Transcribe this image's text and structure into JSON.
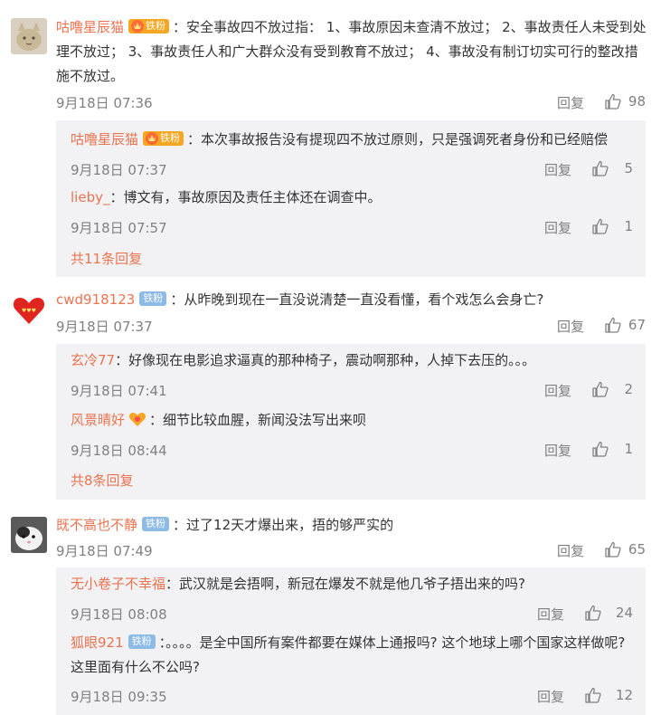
{
  "comments": [
    {
      "user": "咕噜星辰猫",
      "badge": "铁粉",
      "text": "安全事故四不放过指： 1、事故原因未查清不放过； 2、事故责任人未受到处理不放过； 3、事故责任人和广大群众没有受到教育不放过； 4、事故没有制订切实可行的整改措施不放过。",
      "time": "9月18日 07:36",
      "reply_label": "回复",
      "likes": "98",
      "replies": [
        {
          "user": "咕噜星辰猫",
          "badge": "铁粉",
          "text": "本次事故报告没有提现四不放过原则，只是强调死者身份和已经赔偿",
          "time": "9月18日 07:37",
          "reply_label": "回复",
          "likes": "5"
        },
        {
          "user": "lieby_",
          "text": "博文有，事故原因及责任主体还在调查中。",
          "time": "9月18日 07:57",
          "reply_label": "回复",
          "likes": "1"
        }
      ],
      "more": "共11条回复"
    },
    {
      "user": "cwd918123",
      "badge": "铁粉",
      "text": "从昨晚到现在一直没说清楚一直没看懂，看个戏怎么会身亡?",
      "time": "9月18日 07:37",
      "reply_label": "回复",
      "likes": "67",
      "replies": [
        {
          "user": "玄冷77",
          "text": "好像现在电影追求逼真的那种椅子，震动啊那种，人掉下去压的。。。",
          "time": "9月18日 07:41",
          "reply_label": "回复",
          "likes": "2"
        },
        {
          "user": "风景晴好",
          "text": "细节比较血腥，新闻没法写出来呗",
          "time": "9月18日 08:44",
          "reply_label": "回复",
          "likes": "1"
        }
      ],
      "more": "共8条回复"
    },
    {
      "user": "既不高也不静",
      "badge": "铁粉",
      "text": "过了12天才爆出来，捂的够严实的",
      "time": "9月18日 07:49",
      "reply_label": "回复",
      "likes": "65",
      "replies": [
        {
          "user": "无小卷子不幸福",
          "text": "武汉就是会捂啊，新冠在爆发不就是他几爷子捂出来的吗?",
          "time": "9月18日 08:08",
          "reply_label": "回复",
          "likes": "24"
        },
        {
          "user": "狐眼921",
          "badge": "铁粉",
          "text": "。。。。是全中国所有案件都要在媒体上通报吗? 这个地球上哪个国家这样做呢? 这里面有什么不公吗?",
          "time": "9月18日 09:35",
          "reply_label": "回复",
          "likes": "12"
        }
      ]
    }
  ],
  "colors": {
    "username": "#eb7350",
    "meta": "#808080",
    "reply_bg": "#f2f2f5",
    "iron_badge": "#8dbbe8"
  }
}
